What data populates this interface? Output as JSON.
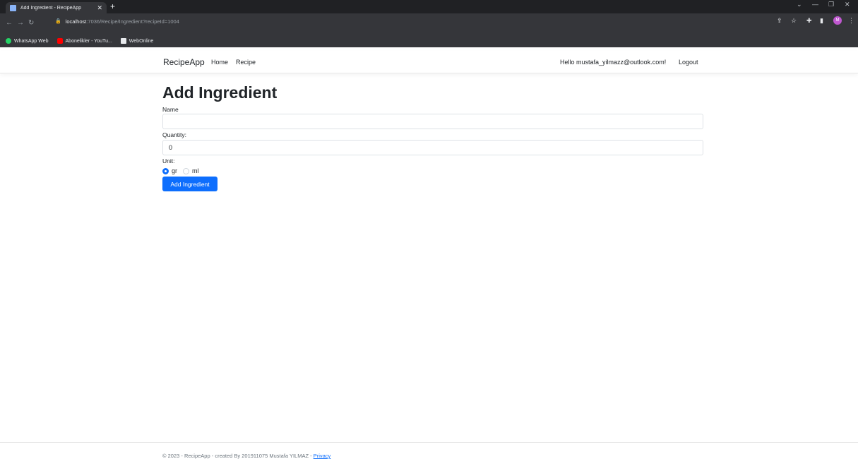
{
  "browser": {
    "tab_title": "Add Ingredient - RecipeApp",
    "url_host": "localhost",
    "url_path": ":7036/Recipe/Ingredient?recipeId=1004",
    "bookmarks": [
      "WhatsApp Web",
      "Abonelikler - YouTu...",
      "WebOnline"
    ],
    "profile_initial": "M",
    "accent": "#c058d0"
  },
  "nav": {
    "brand": "RecipeApp",
    "links": [
      "Home",
      "Recipe"
    ],
    "greeting": "Hello mustafa_yilmazz@outlook.com!",
    "logout": "Logout"
  },
  "form": {
    "title": "Add Ingredient",
    "name_label": "Name",
    "name_value": "",
    "quantity_label": "Quantity:",
    "quantity_value": "0",
    "unit_label": "Unit:",
    "unit_options": [
      "gr",
      "ml"
    ],
    "unit_selected": "gr",
    "submit_label": "Add Ingredient",
    "primary_color": "#0d6efd"
  },
  "footer": {
    "text": "© 2023 - RecipeApp - created By 201911075 Mustafa YILMAZ - ",
    "privacy": "Privacy"
  }
}
